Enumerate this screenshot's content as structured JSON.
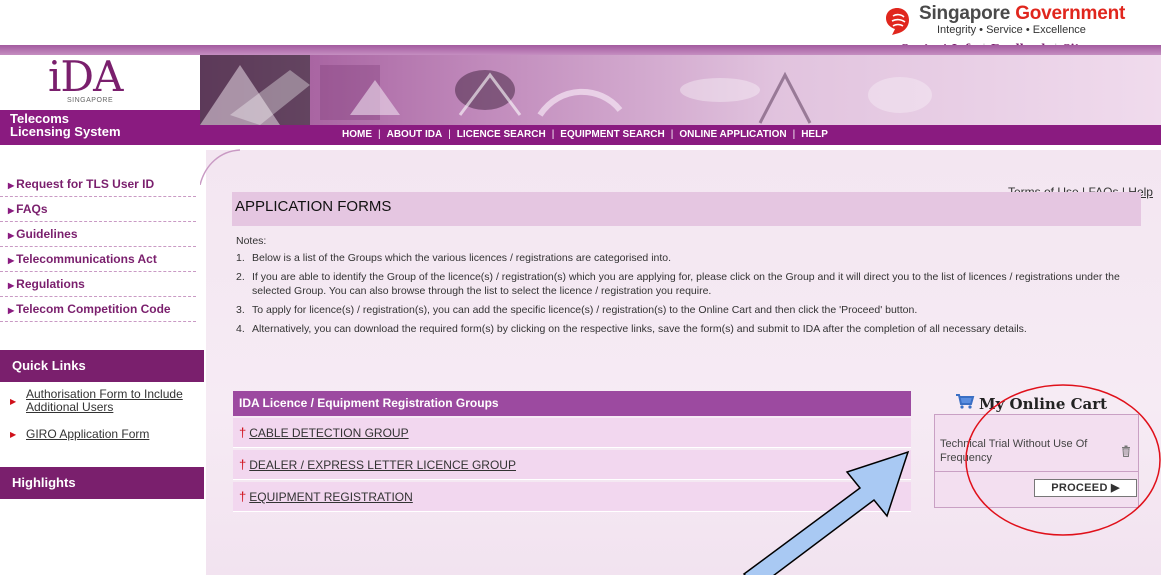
{
  "gov": {
    "title_part1": "Singapore ",
    "title_part2": "Government",
    "tagline": "Integrity • Service • Excellence",
    "links": [
      "Contact Info",
      "Feedback",
      "Sitemap"
    ]
  },
  "brand": {
    "logo": "iDA",
    "logo_sub": "SINGAPORE",
    "system_line1": "Telecoms",
    "system_line2": "Licensing System"
  },
  "nav": [
    "HOME",
    "ABOUT IDA",
    "LICENCE SEARCH",
    "EQUIPMENT SEARCH",
    "ONLINE APPLICATION",
    "HELP"
  ],
  "sidebar": {
    "links": [
      "Request for TLS User ID",
      "FAQs",
      "Guidelines",
      "Telecommunications Act",
      "Regulations",
      "Telecom Competition Code"
    ],
    "quick_links_heading": "Quick Links",
    "quick_links": [
      "Authorisation Form to Include Additional Users",
      "GIRO Application Form"
    ],
    "highlights_heading": "Highlights"
  },
  "top_links": [
    "Terms of Use",
    "FAQs",
    "Help"
  ],
  "page_title": "APPLICATION FORMS",
  "notes": {
    "heading": "Notes:",
    "items": [
      "Below is a list of the Groups which the various licences / registrations are categorised into.",
      "If you are able to identify the Group of the licence(s) / registration(s) which you are applying for, please click on the Group and it will direct you to the list of licences / registrations under the selected Group. You can also browse through the list to select the licence / registration you require.",
      "To apply for licence(s) / registration(s), you can add the specific licence(s) / registration(s) to the Online Cart and then click the 'Proceed' button.",
      "Alternatively, you can download the required form(s) by clicking on the respective links, save the form(s) and submit to IDA after the completion of all necessary details."
    ]
  },
  "groups": {
    "heading": "IDA Licence / Equipment Registration Groups",
    "items": [
      "CABLE DETECTION GROUP",
      "DEALER / EXPRESS LETTER LICENCE GROUP",
      "EQUIPMENT REGISTRATION"
    ]
  },
  "cart": {
    "title": "My Online Cart",
    "item": "Technical Trial Without Use Of Frequency",
    "proceed_label": "PROCEED ▶"
  },
  "colors": {
    "brand_purple": "#8a1b80",
    "annotation_arrow": "#a9c9f3",
    "annotation_circle": "#e0101a"
  }
}
